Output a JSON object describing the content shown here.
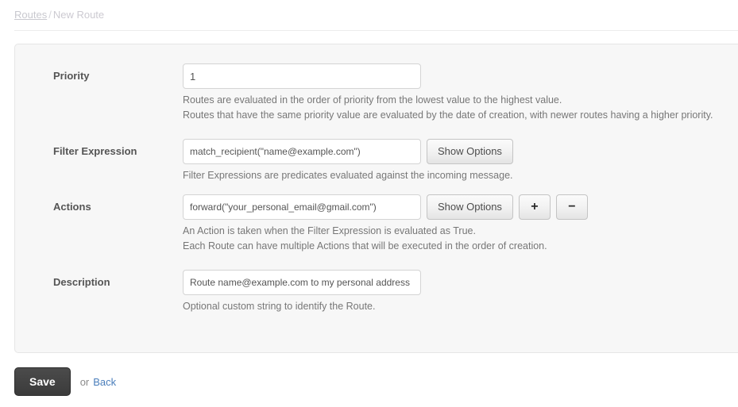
{
  "breadcrumb": {
    "root_label": "Routes",
    "separator": "/",
    "current_label": "New Route"
  },
  "form": {
    "priority": {
      "label": "Priority",
      "value": "1",
      "help_line1": "Routes are evaluated in the order of priority from the lowest value to the highest value.",
      "help_line2": "Routes that have the same priority value are evaluated by the date of creation, with newer routes having a higher priority."
    },
    "filter_expression": {
      "label": "Filter Expression",
      "value": "match_recipient(\"name@example.com\")",
      "show_options_label": "Show Options",
      "help_line1": "Filter Expressions are predicates evaluated against the incoming message."
    },
    "actions": {
      "label": "Actions",
      "value": "forward(\"your_personal_email@gmail.com\")",
      "show_options_label": "Show Options",
      "add_label": "+",
      "remove_label": "−",
      "help_line1": "An Action is taken when the Filter Expression is evaluated as True.",
      "help_line2": "Each Route can have multiple Actions that will be executed in the order of creation."
    },
    "description": {
      "label": "Description",
      "value": "Route name@example.com to my personal address",
      "help_line1": "Optional custom string to identify the Route."
    }
  },
  "footer": {
    "save_label": "Save",
    "or_label": "or",
    "back_label": "Back"
  },
  "colors": {
    "panel_background": "#f7f7f7",
    "label_text": "#555555",
    "help_text": "#777777",
    "link": "#4a7ebb",
    "breadcrumb": "#c9c9cf",
    "save_button": "#3b3b3b"
  }
}
